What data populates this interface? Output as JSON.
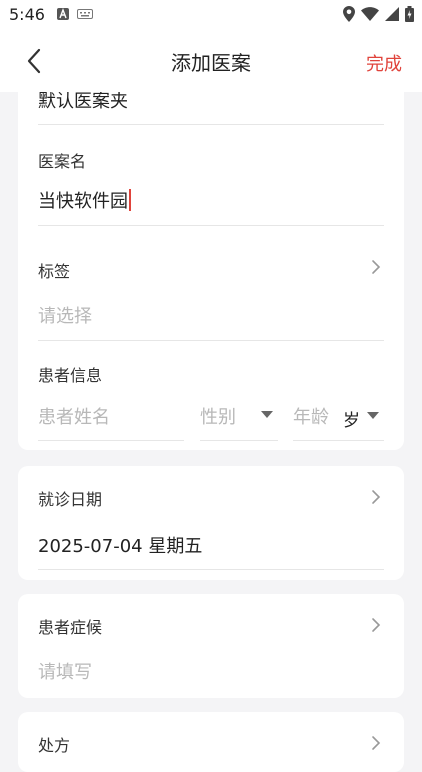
{
  "status_bar": {
    "time": "5:46"
  },
  "header": {
    "title": "添加医案",
    "done_label": "完成"
  },
  "folder": {
    "value": "默认医案夹"
  },
  "case_name": {
    "label": "医案名",
    "value": "当快软件园"
  },
  "tags": {
    "label": "标签",
    "placeholder": "请选择"
  },
  "patient": {
    "label": "患者信息",
    "name_placeholder": "患者姓名",
    "gender_placeholder": "性别",
    "age_placeholder": "年龄",
    "age_unit": "岁"
  },
  "visit_date": {
    "label": "就诊日期",
    "value": "2025-07-04 星期五"
  },
  "symptoms": {
    "label": "患者症候",
    "placeholder": "请填写"
  },
  "prescription": {
    "label": "处方"
  },
  "colors": {
    "accent": "#e0433b",
    "background": "#f4f4f6"
  }
}
